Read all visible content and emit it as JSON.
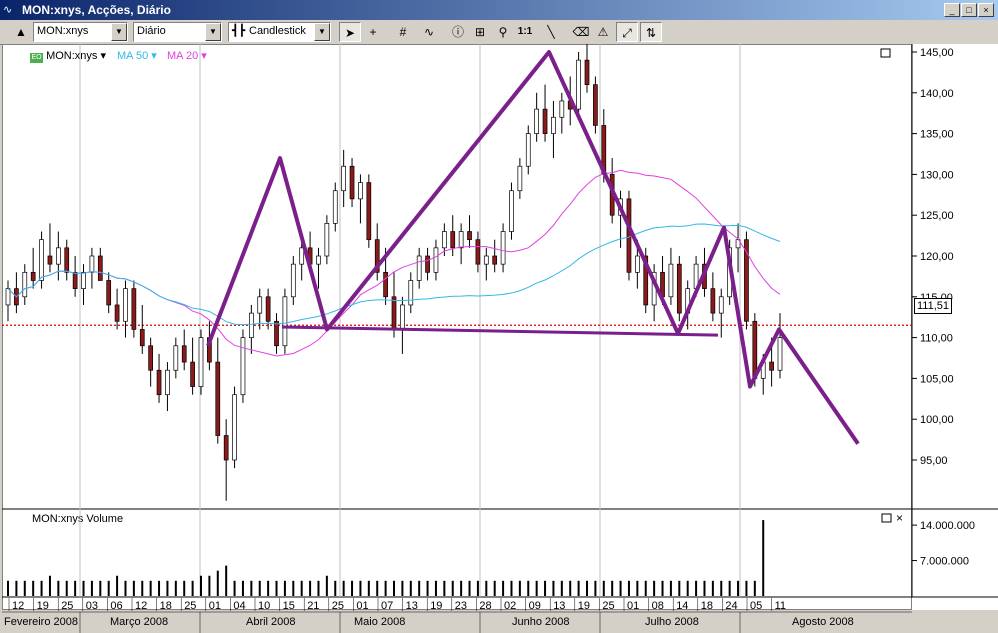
{
  "window": {
    "title": "MON:xnys, Acções, Diário",
    "controls": [
      "_",
      "□",
      "×"
    ]
  },
  "toolbar": {
    "symbol": "MON:xnys",
    "period": "Diário",
    "chart_style": "Candlestick",
    "tools": [
      "pointer-icon",
      "crosshair-icon",
      "grid-icon",
      "indicator-icon",
      "info-icon",
      "insert-icon",
      "zoom-icon",
      "1:1",
      "line-icon",
      "eraser-icon",
      "alert-icon",
      "zoom-fit-icon",
      "scale-icon"
    ]
  },
  "legend": {
    "series": [
      {
        "label": "MON:xnys",
        "color": "#000000"
      },
      {
        "label": "MA 50",
        "color": "#33b8e8"
      },
      {
        "label": "MA 20",
        "color": "#e040e0"
      }
    ]
  },
  "volume_panel": {
    "label": "MON:xnys Volume"
  },
  "price_axis": {
    "ticks": [
      "145,00",
      "140,00",
      "135,00",
      "130,00",
      "125,00",
      "120,00",
      "115,00",
      "110,00",
      "105,00",
      "100,00",
      "95,00"
    ],
    "current_price": "111,51"
  },
  "volume_axis": {
    "ticks": [
      "14.000.000",
      "7.000.000"
    ]
  },
  "date_axis": {
    "days": [
      "12",
      "19",
      "25",
      "03",
      "06",
      "12",
      "18",
      "25",
      "01",
      "04",
      "10",
      "15",
      "21",
      "25",
      "01",
      "07",
      "13",
      "19",
      "23",
      "28",
      "02",
      "09",
      "13",
      "19",
      "25",
      "01",
      "08",
      "14",
      "18",
      "24",
      "05",
      "11"
    ],
    "months": [
      "Fevereiro 2008",
      "Março 2008",
      "Abril 2008",
      "Maio 2008",
      "Junho 2008",
      "Julho 2008",
      "Agosto 2008"
    ]
  },
  "colors": {
    "bull": "#ffffff",
    "bear": "#8b1a1a",
    "pattern": "#7b1f8a",
    "support": "#7b1f8a",
    "price_line": "#cc0000"
  },
  "chart_data": {
    "type": "candlestick",
    "ylim": [
      88,
      148
    ],
    "y_ticks": [
      145,
      140,
      135,
      130,
      125,
      120,
      115,
      110,
      105,
      100,
      95
    ],
    "current_price": 111.51,
    "pattern_line": {
      "description_points": [
        {
          "x": "2008-03-31",
          "y": 109
        },
        {
          "x": "2008-04-15",
          "y": 132
        },
        {
          "x": "2008-04-25",
          "y": 111
        },
        {
          "x": "2008-06-13",
          "y": 145
        },
        {
          "x": "2008-07-18",
          "y": 110.5
        },
        {
          "x": "2008-07-25",
          "y": 123.5
        },
        {
          "x": "2008-08-05",
          "y": 104
        },
        {
          "x": "2008-08-11",
          "y": 111
        },
        {
          "x": "2008-08-29",
          "y": 97
        }
      ]
    },
    "support_line": {
      "y": 110.8
    },
    "ohlc": [
      [
        114,
        117,
        112,
        116
      ],
      [
        116,
        118,
        113,
        114
      ],
      [
        115,
        119,
        114,
        118
      ],
      [
        118,
        121,
        116,
        117
      ],
      [
        117,
        123,
        116,
        122
      ],
      [
        120,
        124,
        118,
        119
      ],
      [
        119,
        123,
        117,
        121
      ],
      [
        121,
        122,
        117,
        118
      ],
      [
        118,
        120,
        115,
        116
      ],
      [
        116,
        119,
        114,
        118
      ],
      [
        118,
        121,
        116,
        120
      ],
      [
        120,
        121,
        117,
        117
      ],
      [
        117,
        118,
        113,
        114
      ],
      [
        114,
        116,
        111,
        112
      ],
      [
        112,
        117,
        110,
        116
      ],
      [
        116,
        117,
        110,
        111
      ],
      [
        111,
        114,
        108,
        109
      ],
      [
        109,
        110,
        104,
        106
      ],
      [
        106,
        108,
        102,
        103
      ],
      [
        103,
        107,
        101,
        106
      ],
      [
        106,
        110,
        105,
        109
      ],
      [
        109,
        111,
        106,
        107
      ],
      [
        107,
        110,
        103,
        104
      ],
      [
        104,
        111,
        103,
        110
      ],
      [
        110,
        112,
        106,
        107
      ],
      [
        107,
        110,
        97,
        98
      ],
      [
        98,
        100,
        90,
        95
      ],
      [
        95,
        104,
        94,
        103
      ],
      [
        103,
        111,
        102,
        110
      ],
      [
        110,
        114,
        108,
        113
      ],
      [
        113,
        116,
        111,
        115
      ],
      [
        115,
        116,
        111,
        112
      ],
      [
        112,
        113,
        108,
        109
      ],
      [
        109,
        116,
        108,
        115
      ],
      [
        115,
        120,
        114,
        119
      ],
      [
        119,
        122,
        117,
        121
      ],
      [
        121,
        123,
        118,
        119
      ],
      [
        119,
        121,
        116,
        120
      ],
      [
        120,
        125,
        119,
        124
      ],
      [
        124,
        129,
        123,
        128
      ],
      [
        128,
        133,
        126,
        131
      ],
      [
        131,
        132,
        126,
        127
      ],
      [
        127,
        130,
        124,
        129
      ],
      [
        129,
        130,
        121,
        122
      ],
      [
        122,
        124,
        117,
        118
      ],
      [
        118,
        121,
        114,
        115
      ],
      [
        115,
        118,
        110,
        111
      ],
      [
        111,
        115,
        108,
        114
      ],
      [
        114,
        118,
        113,
        117
      ],
      [
        117,
        121,
        116,
        120
      ],
      [
        120,
        121,
        117,
        118
      ],
      [
        118,
        122,
        117,
        121
      ],
      [
        121,
        124,
        120,
        123
      ],
      [
        123,
        125,
        120,
        121
      ],
      [
        121,
        124,
        119,
        123
      ],
      [
        123,
        125,
        121,
        122
      ],
      [
        122,
        123,
        118,
        119
      ],
      [
        119,
        121,
        117,
        120
      ],
      [
        120,
        122,
        118,
        119
      ],
      [
        119,
        124,
        118,
        123
      ],
      [
        123,
        129,
        122,
        128
      ],
      [
        128,
        132,
        127,
        131
      ],
      [
        131,
        136,
        130,
        135
      ],
      [
        135,
        140,
        134,
        138
      ],
      [
        138,
        141,
        134,
        135
      ],
      [
        135,
        139,
        132,
        137
      ],
      [
        137,
        140,
        135,
        139
      ],
      [
        139,
        142,
        136,
        138
      ],
      [
        138,
        145,
        137,
        144
      ],
      [
        144,
        146,
        140,
        141
      ],
      [
        141,
        142,
        135,
        136
      ],
      [
        136,
        138,
        129,
        130
      ],
      [
        130,
        132,
        124,
        125
      ],
      [
        125,
        128,
        121,
        127
      ],
      [
        127,
        128,
        117,
        118
      ],
      [
        118,
        122,
        116,
        120
      ],
      [
        120,
        121,
        113,
        114
      ],
      [
        114,
        119,
        112,
        118
      ],
      [
        118,
        120,
        114,
        115
      ],
      [
        115,
        121,
        114,
        119
      ],
      [
        119,
        120,
        112,
        113
      ],
      [
        113,
        117,
        111,
        116
      ],
      [
        116,
        120,
        115,
        119
      ],
      [
        119,
        121,
        115,
        116
      ],
      [
        116,
        118,
        112,
        113
      ],
      [
        113,
        116,
        110,
        115
      ],
      [
        115,
        122,
        114,
        121
      ],
      [
        121,
        124,
        118,
        122
      ],
      [
        122,
        123,
        111,
        112
      ],
      [
        112,
        113,
        104,
        105
      ],
      [
        105,
        108,
        103,
        107
      ],
      [
        107,
        110,
        104,
        106
      ],
      [
        106,
        113,
        105,
        110
      ]
    ],
    "volume_ylim": [
      0,
      16000000
    ],
    "volume": [
      3,
      3,
      3,
      3,
      3,
      4,
      3,
      3,
      3,
      3,
      3,
      3,
      3,
      4,
      3,
      3,
      3,
      3,
      3,
      3,
      3,
      3,
      3,
      4,
      4,
      5,
      6,
      3,
      3,
      3,
      3,
      3,
      3,
      3,
      3,
      3,
      3,
      3,
      4,
      3,
      3,
      3,
      3,
      3,
      3,
      3,
      3,
      3,
      3,
      3,
      3,
      3,
      3,
      3,
      3,
      3,
      3,
      3,
      3,
      3,
      3,
      3,
      3,
      3,
      3,
      3,
      3,
      3,
      3,
      3,
      3,
      3,
      3,
      3,
      3,
      3,
      3,
      3,
      3,
      3,
      3,
      3,
      3,
      3,
      3,
      3,
      3,
      3,
      3,
      3,
      15
    ]
  }
}
